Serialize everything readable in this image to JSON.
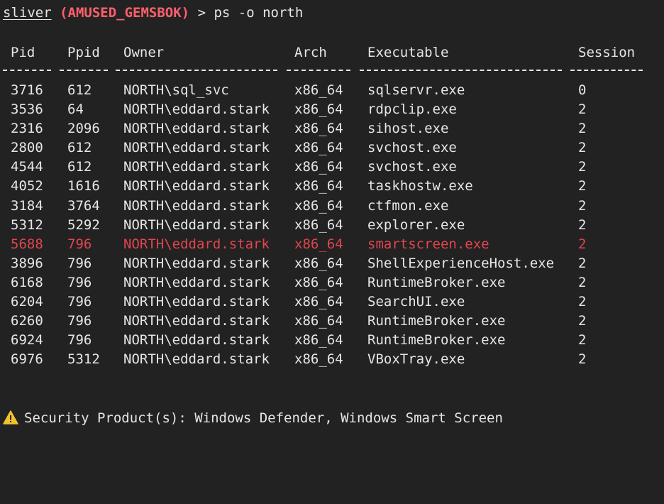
{
  "prompt": {
    "user": "sliver",
    "session": "(AMUSED_GEMSBOK)",
    "arrow": ">",
    "command": "ps -o north"
  },
  "table": {
    "headers": {
      "pid": "Pid",
      "ppid": "Ppid",
      "owner": "Owner",
      "arch": "Arch",
      "executable": "Executable",
      "session": "Session"
    },
    "rows": [
      {
        "pid": "3716",
        "ppid": "612",
        "owner": "NORTH\\sql_svc",
        "arch": "x86_64",
        "executable": "sqlservr.exe",
        "session": "0"
      },
      {
        "pid": "3536",
        "ppid": "64",
        "owner": "NORTH\\eddard.stark",
        "arch": "x86_64",
        "executable": "rdpclip.exe",
        "session": "2"
      },
      {
        "pid": "2316",
        "ppid": "2096",
        "owner": "NORTH\\eddard.stark",
        "arch": "x86_64",
        "executable": "sihost.exe",
        "session": "2"
      },
      {
        "pid": "2800",
        "ppid": "612",
        "owner": "NORTH\\eddard.stark",
        "arch": "x86_64",
        "executable": "svchost.exe",
        "session": "2"
      },
      {
        "pid": "4544",
        "ppid": "612",
        "owner": "NORTH\\eddard.stark",
        "arch": "x86_64",
        "executable": "svchost.exe",
        "session": "2"
      },
      {
        "pid": "4052",
        "ppid": "1616",
        "owner": "NORTH\\eddard.stark",
        "arch": "x86_64",
        "executable": "taskhostw.exe",
        "session": "2"
      },
      {
        "pid": "3184",
        "ppid": "3764",
        "owner": "NORTH\\eddard.stark",
        "arch": "x86_64",
        "executable": "ctfmon.exe",
        "session": "2"
      },
      {
        "pid": "5312",
        "ppid": "5292",
        "owner": "NORTH\\eddard.stark",
        "arch": "x86_64",
        "executable": "explorer.exe",
        "session": "2"
      },
      {
        "pid": "5688",
        "ppid": "796",
        "owner": "NORTH\\eddard.stark",
        "arch": "x86_64",
        "executable": "smartscreen.exe",
        "session": "2"
      },
      {
        "pid": "3896",
        "ppid": "796",
        "owner": "NORTH\\eddard.stark",
        "arch": "x86_64",
        "executable": "ShellExperienceHost.exe",
        "session": "2"
      },
      {
        "pid": "6168",
        "ppid": "796",
        "owner": "NORTH\\eddard.stark",
        "arch": "x86_64",
        "executable": "RuntimeBroker.exe",
        "session": "2"
      },
      {
        "pid": "6204",
        "ppid": "796",
        "owner": "NORTH\\eddard.stark",
        "arch": "x86_64",
        "executable": "SearchUI.exe",
        "session": "2"
      },
      {
        "pid": "6260",
        "ppid": "796",
        "owner": "NORTH\\eddard.stark",
        "arch": "x86_64",
        "executable": "RuntimeBroker.exe",
        "session": "2"
      },
      {
        "pid": "6924",
        "ppid": "796",
        "owner": "NORTH\\eddard.stark",
        "arch": "x86_64",
        "executable": "RuntimeBroker.exe",
        "session": "2"
      },
      {
        "pid": "6976",
        "ppid": "5312",
        "owner": "NORTH\\eddard.stark",
        "arch": "x86_64",
        "executable": "VBoxTray.exe",
        "session": "2"
      }
    ]
  },
  "colors": {
    "background": "#222222",
    "text": "#e6e6e6",
    "session_name": "#ff5f6d",
    "highlight_row": "#e3454e",
    "warning_icon": "#f2c12e"
  },
  "warning": {
    "icon": "warning-icon",
    "text": "Security Product(s): Windows Defender, Windows Smart Screen"
  }
}
